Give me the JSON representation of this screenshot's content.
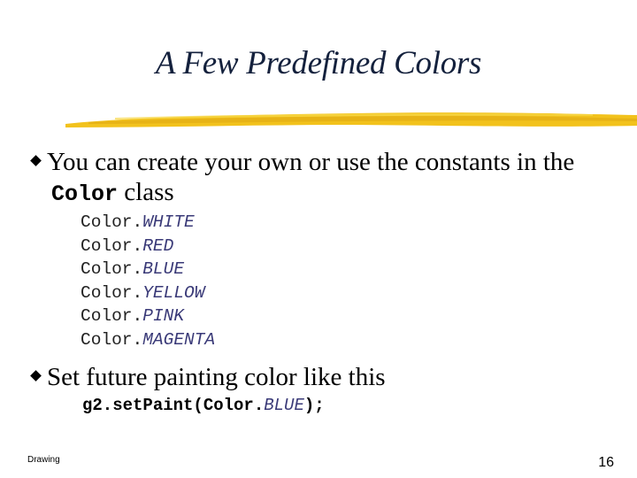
{
  "slide": {
    "title": "A Few Predefined Colors",
    "accent_color": "#f2c21c",
    "bullets": [
      {
        "text_line1": "You can create your own or use the constants in the",
        "code_word": "Color",
        "text_line2_suffix": " class"
      },
      {
        "text_line1": "Set future painting color like this"
      }
    ],
    "color_constants": [
      {
        "prefix": "Color.",
        "name": "WHITE"
      },
      {
        "prefix": "Color.",
        "name": "RED"
      },
      {
        "prefix": "Color.",
        "name": "BLUE"
      },
      {
        "prefix": "Color.",
        "name": "YELLOW"
      },
      {
        "prefix": "Color.",
        "name": "PINK"
      },
      {
        "prefix": "Color.",
        "name": "MAGENTA"
      }
    ],
    "code_example": {
      "before": "g2.setPaint(Color.",
      "constant": "BLUE",
      "after": ");"
    },
    "footer": {
      "left": "Drawing",
      "page_number": "16"
    }
  }
}
